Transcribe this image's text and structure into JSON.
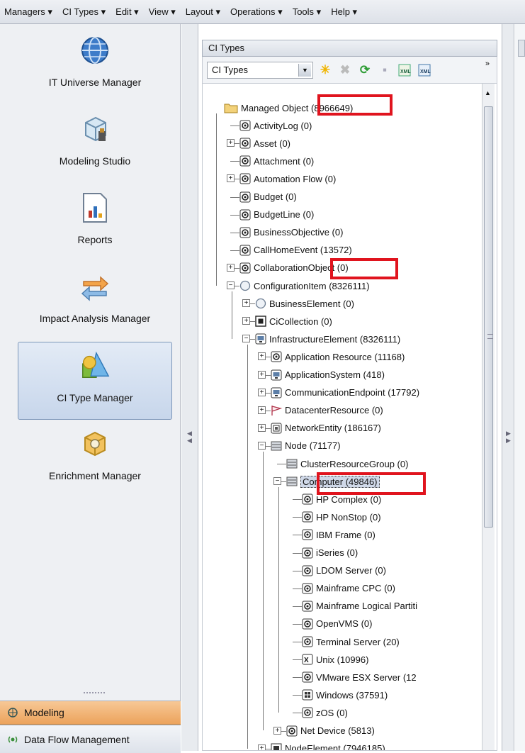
{
  "menubar": [
    "Managers ▾",
    "CI Types ▾",
    "Edit ▾",
    "View ▾",
    "Layout ▾",
    "Operations ▾",
    "Tools ▾",
    "Help ▾"
  ],
  "nav": {
    "items": [
      {
        "label": "IT Universe Manager",
        "icon": "globe-icon"
      },
      {
        "label": "Modeling Studio",
        "icon": "modeling-studio-icon"
      },
      {
        "label": "Reports",
        "icon": "report-chart-icon"
      },
      {
        "label": "Impact Analysis Manager",
        "icon": "impact-arrows-icon"
      },
      {
        "label": "CI Type Manager",
        "icon": "ci-type-shapes-icon",
        "selected": true
      },
      {
        "label": "Enrichment Manager",
        "icon": "enrichment-box-icon"
      }
    ],
    "bottom": [
      "Modeling",
      "Data Flow Management"
    ]
  },
  "panel": {
    "title": "CI Types",
    "combo_value": "CI Types",
    "overflow": "»"
  },
  "tree": [
    {
      "label": "Managed Object (8966649)"
    },
    {
      "label": "ActivityLog (0)"
    },
    {
      "label": "Asset (0)"
    },
    {
      "label": "Attachment (0)"
    },
    {
      "label": "Automation Flow (0)"
    },
    {
      "label": "Budget (0)"
    },
    {
      "label": "BudgetLine (0)"
    },
    {
      "label": "BusinessObjective (0)"
    },
    {
      "label": "CallHomeEvent (13572)"
    },
    {
      "label": "CollaborationObject (0)"
    },
    {
      "label": "ConfigurationItem (8326111)"
    },
    {
      "label": "BusinessElement (0)"
    },
    {
      "label": "CiCollection (0)"
    },
    {
      "label": "InfrastructureElement (8326111)"
    },
    {
      "label": "Application Resource (11168)"
    },
    {
      "label": "ApplicationSystem (418)"
    },
    {
      "label": "CommunicationEndpoint (17792)"
    },
    {
      "label": "DatacenterResource (0)"
    },
    {
      "label": "NetworkEntity (186167)"
    },
    {
      "label": "Node (71177)"
    },
    {
      "label": "ClusterResourceGroup (0)"
    },
    {
      "label": "Computer (49846)"
    },
    {
      "label": "HP Complex (0)"
    },
    {
      "label": "HP NonStop (0)"
    },
    {
      "label": "IBM Frame (0)"
    },
    {
      "label": "iSeries (0)"
    },
    {
      "label": "LDOM Server (0)"
    },
    {
      "label": "Mainframe CPC (0)"
    },
    {
      "label": "Mainframe Logical Partiti"
    },
    {
      "label": "OpenVMS (0)"
    },
    {
      "label": "Terminal Server (20)"
    },
    {
      "label": "Unix (10996)"
    },
    {
      "label": "VMware ESX Server (12"
    },
    {
      "label": "Windows (37591)"
    },
    {
      "label": "zOS (0)"
    },
    {
      "label": "Net Device (5813)"
    },
    {
      "label": "NodeElement (7946185)"
    }
  ],
  "colors": {
    "highlight_box": "#e0141e",
    "selected_nav": "#c7d6eb",
    "modeling_tab": "#eca35c"
  }
}
